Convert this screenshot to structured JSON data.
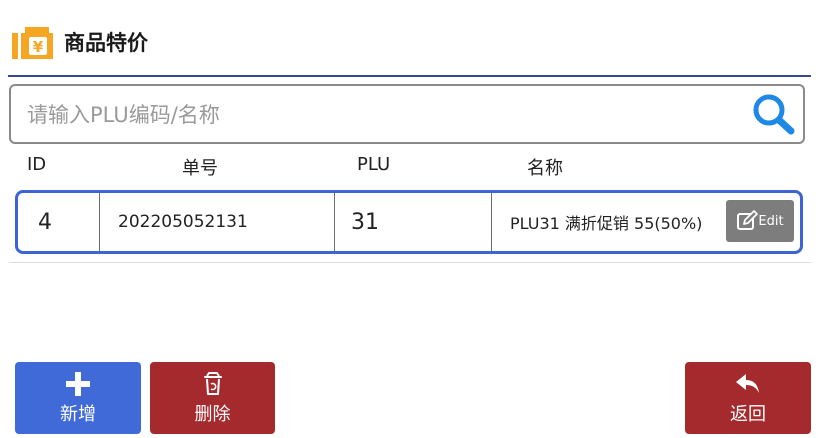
{
  "header": {
    "title": "商品特价",
    "logo_icon": "price-tag-yen-icon",
    "logo_text": "¥"
  },
  "search": {
    "placeholder": "请输入PLU编码/名称",
    "value": ""
  },
  "table": {
    "headers": {
      "id": "ID",
      "number": "单号",
      "plu": "PLU",
      "name": "名称"
    },
    "rows": [
      {
        "id": "4",
        "number": "202205052131",
        "plu": "31",
        "name": "PLU31 满折促销 55(50%)",
        "edit_label": "Edit"
      }
    ]
  },
  "buttons": {
    "add": "新增",
    "delete": "删除",
    "back": "返回"
  },
  "colors": {
    "accent": "#3d64d4",
    "add": "#3f6ad8",
    "danger": "#a52a2e",
    "logo": "#f5a623",
    "edit": "#7d7d7d"
  }
}
